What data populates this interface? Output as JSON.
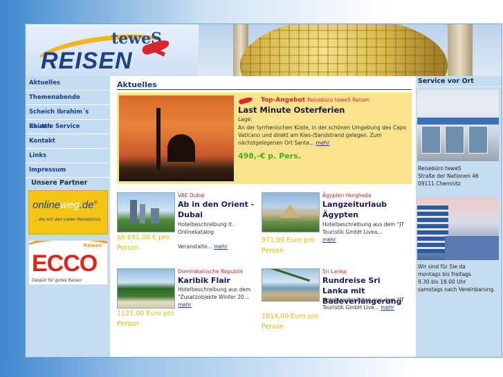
{
  "logo": {
    "top": "teweS",
    "main": "REISEN"
  },
  "nav": {
    "items": [
      "Aktuelles",
      "Themenabende",
      "Scheich Ibrahim´s Reisen",
      "Shuttle Service",
      "Kontakt",
      "Links",
      "Impressum"
    ],
    "partners_heading": "Unsere Partner"
  },
  "partners": {
    "onlineweg": {
      "name_a": "online",
      "name_b": "weg",
      "name_c": ".de",
      "mark": "®",
      "slogan": "...die mit den vielen Reisebüros."
    },
    "ecco": {
      "tag": "Reisen",
      "name": "Ecco",
      "slogan": "Gespür für gutes Reisen"
    }
  },
  "main": {
    "title": "Aktuelles",
    "top_offer": {
      "label": "Top-Angebot",
      "agency": "Reisebüro teweS Reisen",
      "headline": "Last Minute Osterferien",
      "lage": "Lage:",
      "description": "An der tyrrhenischen Küste, in der schönen Umgebung des Capo Vaticano und direkt am Kies-/Sandstrand gelegen. Zum nächstgelegenen Ort Santa...",
      "more": "mehr",
      "price": "498,-€ p. Pers."
    },
    "offers": [
      {
        "region": "VAE Dubai",
        "title": "Ab in den Orient - Dubai",
        "desc1": "Hotelbeschreibung lt. Onlinekatalog",
        "desc2": "Veranstalte...",
        "more": "mehr",
        "price": "ab 691,00 € pro Person"
      },
      {
        "region": "Ägypten Hurghada",
        "title": "Langzeiturlaub Ägypten",
        "desc1": "Hotelbeschreibung aus dem \"JT Touristik GmbH Livea...",
        "desc2": "",
        "more": "mehr",
        "price": "971,00 Euro pro Person"
      },
      {
        "region": "Dominikanische Republik",
        "title": "Karibik Flair",
        "desc1": "Hotelbeschreibung aus dem \"Zusatzobjekte Winter 20...",
        "desc2": "",
        "more": "mehr",
        "price": "1121,00 Euro pro Person"
      },
      {
        "region": "Sri Lanka",
        "title": "Rundreise Sri Lanka mit Badeverlängerung",
        "desc1": "Hotelbeschreibung aus dem \"JT Touristik GmbH Live...",
        "desc2": "",
        "more": "mehr",
        "price": "1814,00 Euro pro Person"
      }
    ]
  },
  "right": {
    "title": "Service vor Ort",
    "address": [
      "Reisebüro teweS",
      "Straße der Nationen 46",
      "09111 Chemnitz"
    ],
    "hours": [
      "Wir sind für Sie da",
      "montags bis freitags",
      "9.30 bis 18.00 Uhr",
      "samstags nach Vereinbarung."
    ]
  },
  "colors": {
    "nav_bg": "#c4dcf2",
    "nav_text": "#1a3a8c",
    "offer_bg": "#fbe28d",
    "price_green": "#3bb31c",
    "price_yellow": "#e8b800",
    "region_red": "#c8252b"
  }
}
